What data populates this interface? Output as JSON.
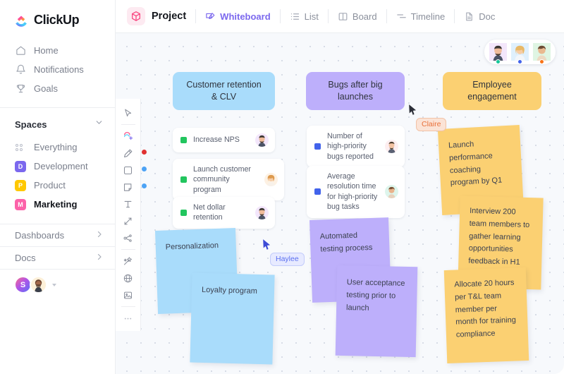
{
  "app": {
    "brand": "ClickUp",
    "brand_icon": "clickup-logo-icon"
  },
  "sidebar": {
    "nav": [
      {
        "label": "Home",
        "icon": "home-icon"
      },
      {
        "label": "Notifications",
        "icon": "bell-icon"
      },
      {
        "label": "Goals",
        "icon": "trophy-icon"
      }
    ],
    "spaces_header": "Spaces",
    "spaces_collapse_icon": "chevron-down-icon",
    "spaces": [
      {
        "label": "Everything",
        "icon": "grid-dots-icon",
        "badge": "",
        "color": "",
        "active": false
      },
      {
        "label": "Development",
        "icon": "space-badge",
        "badge": "D",
        "color": "#7b68ee",
        "active": false
      },
      {
        "label": "Product",
        "icon": "space-badge",
        "badge": "P",
        "color": "#ffc800",
        "active": false
      },
      {
        "label": "Marketing",
        "icon": "space-badge",
        "badge": "M",
        "color": "#fc62a9",
        "active": true
      }
    ],
    "footer": [
      {
        "label": "Dashboards",
        "icon": "chevron-right-icon"
      },
      {
        "label": "Docs",
        "icon": "chevron-right-icon"
      }
    ],
    "user": {
      "initial": "S",
      "avatar": "user-avatar",
      "caret_icon": "caret-down-icon"
    }
  },
  "topbar": {
    "project_icon": "cube-icon",
    "project_label": "Project",
    "tabs": [
      {
        "label": "Whiteboard",
        "icon": "whiteboard-icon",
        "active": true
      },
      {
        "label": "List",
        "icon": "list-icon",
        "active": false
      },
      {
        "label": "Board",
        "icon": "board-icon",
        "active": false
      },
      {
        "label": "Timeline",
        "icon": "timeline-icon",
        "active": false
      },
      {
        "label": "Doc",
        "icon": "doc-icon",
        "active": false
      }
    ]
  },
  "toolrail": {
    "tools": [
      {
        "name": "select-cursor-tool",
        "dot": ""
      },
      {
        "name": "sticker-tool",
        "dot": ""
      },
      {
        "name": "pen-tool",
        "dot": "#e03131"
      },
      {
        "name": "shape-tool",
        "dot": "#4da3f5"
      },
      {
        "name": "sticky-note-tool",
        "dot": "#4da3f5"
      },
      {
        "name": "text-tool",
        "dot": ""
      },
      {
        "name": "connector-tool",
        "dot": ""
      },
      {
        "name": "mindmap-tool",
        "dot": ""
      },
      {
        "name": "magic-tool",
        "dot": ""
      },
      {
        "name": "embed-tool",
        "dot": ""
      },
      {
        "name": "image-tool",
        "dot": ""
      },
      {
        "name": "more-tool",
        "dot": ""
      }
    ]
  },
  "board": {
    "columns": [
      {
        "title": "Customer retention\n& CLV",
        "header_color": "#a9dcfb",
        "cards": [
          {
            "text": "Increase NPS",
            "marker_color": "#22c55e",
            "avatar": "avatar-male-1"
          },
          {
            "text": "Launch customer community program",
            "marker_color": "#22c55e",
            "avatar": "avatar-female-1"
          },
          {
            "text": "Net dollar retention",
            "marker_color": "#22c55e",
            "avatar": "avatar-male-1"
          }
        ]
      },
      {
        "title": "Bugs after big\nlaunches",
        "header_color": "#bdaffb",
        "cards": [
          {
            "text": "Number of high-priority bugs reported",
            "marker_color": "#4263eb",
            "avatar": "avatar-male-2"
          },
          {
            "text": "Average resolution time for high-priority bug tasks",
            "marker_color": "#4263eb",
            "avatar": "avatar-female-2"
          }
        ]
      },
      {
        "title": "Employee\nengagement",
        "header_color": "#fbd072",
        "cards": []
      }
    ],
    "stickies": [
      {
        "text": "Personalization",
        "color": "#a9dcfb",
        "group": "blue"
      },
      {
        "text": "Loyalty program",
        "color": "#a9dcfb",
        "group": "blue"
      },
      {
        "text": "Automated testing process",
        "color": "#bdaffb",
        "group": "purple"
      },
      {
        "text": "User acceptance testing prior to launch",
        "color": "#bdaffb",
        "group": "purple"
      },
      {
        "text": "Launch performance coaching program by Q1",
        "color": "#fbd072",
        "group": "yellow"
      },
      {
        "text": "Interview 200 team members to gather learning opportunities feedback in H1",
        "color": "#fbd072",
        "group": "yellow"
      },
      {
        "text": "Allocate 20 hours per T&L team member per month for training compliance",
        "color": "#fbd072",
        "group": "yellow"
      }
    ],
    "cursors": [
      {
        "name": "Claire",
        "color": "#e8703a",
        "bg": "#fbe3d6",
        "border": "#f2c2a6"
      },
      {
        "name": "Haylee",
        "color": "#5a6ff0",
        "bg": "#e7eaff",
        "border": "#c3ccfb"
      }
    ],
    "collaborators": [
      {
        "avatar": "avatar-male-1",
        "status_color": "#16c79a"
      },
      {
        "avatar": "avatar-female-1",
        "status_color": "#4263eb"
      },
      {
        "avatar": "avatar-female-2",
        "status_color": "#f97316"
      }
    ]
  }
}
